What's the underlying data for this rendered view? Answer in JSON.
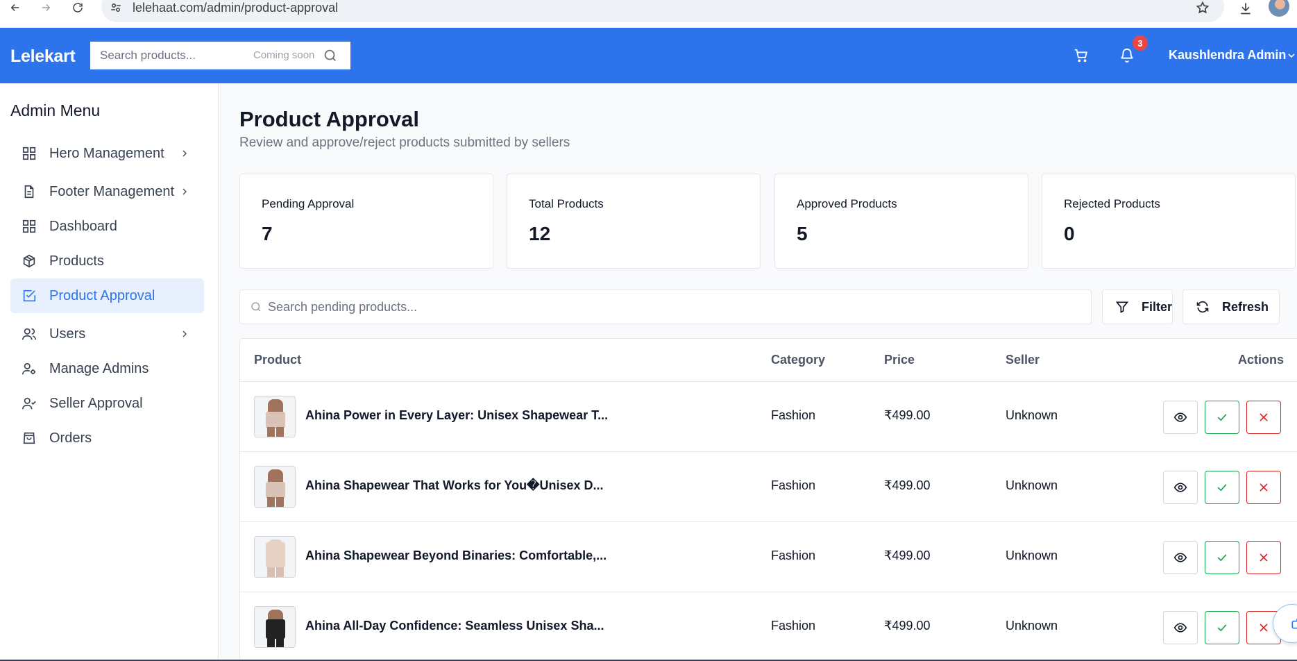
{
  "browser": {
    "url": "lelehaat.com/admin/product-approval"
  },
  "header": {
    "logo": "Lelekart",
    "search_placeholder": "Search products...",
    "coming_soon": "Coming soon",
    "notification_count": "3",
    "user_name": "Kaushlendra Admin"
  },
  "sidebar": {
    "title": "Admin Menu",
    "items": [
      {
        "label": "Hero Management",
        "icon": "grid-icon",
        "has_submenu": true
      },
      {
        "label": "Footer Management",
        "icon": "file-text-icon",
        "has_submenu": true
      },
      {
        "label": "Dashboard",
        "icon": "grid-icon",
        "has_submenu": false
      },
      {
        "label": "Products",
        "icon": "package-icon",
        "has_submenu": false
      },
      {
        "label": "Product Approval",
        "icon": "check-square-icon",
        "has_submenu": false,
        "active": true
      },
      {
        "label": "Users",
        "icon": "users-icon",
        "has_submenu": true
      },
      {
        "label": "Manage Admins",
        "icon": "user-cog-icon",
        "has_submenu": false
      },
      {
        "label": "Seller Approval",
        "icon": "user-check-icon",
        "has_submenu": false
      },
      {
        "label": "Orders",
        "icon": "shopping-bag-icon",
        "has_submenu": false
      }
    ]
  },
  "main": {
    "title": "Product Approval",
    "subtitle": "Review and approve/reject products submitted by sellers",
    "stats": [
      {
        "label": "Pending Approval",
        "value": "7"
      },
      {
        "label": "Total Products",
        "value": "12"
      },
      {
        "label": "Approved Products",
        "value": "5"
      },
      {
        "label": "Rejected Products",
        "value": "0"
      }
    ],
    "search_placeholder": "Search pending products...",
    "filter_label": "Filter",
    "refresh_label": "Refresh",
    "table": {
      "columns": [
        "Product",
        "Category",
        "Price",
        "Seller",
        "Actions"
      ],
      "rows": [
        {
          "product": "Ahina Power in Every Layer: Unisex Shapewear T...",
          "category": "Fashion",
          "price": "₹499.00",
          "seller": "Unknown"
        },
        {
          "product": "Ahina Shapewear That Works for You�Unisex D...",
          "category": "Fashion",
          "price": "₹499.00",
          "seller": "Unknown"
        },
        {
          "product": "Ahina Shapewear Beyond Binaries: Comfortable,...",
          "category": "Fashion",
          "price": "₹499.00",
          "seller": "Unknown"
        },
        {
          "product": "Ahina All-Day Confidence: Seamless Unisex Sha...",
          "category": "Fashion",
          "price": "₹499.00",
          "seller": "Unknown"
        }
      ]
    }
  },
  "colors": {
    "brand": "#2d74ec",
    "approve": "#16a34a",
    "reject": "#dc2626",
    "badge": "#ef4444"
  }
}
